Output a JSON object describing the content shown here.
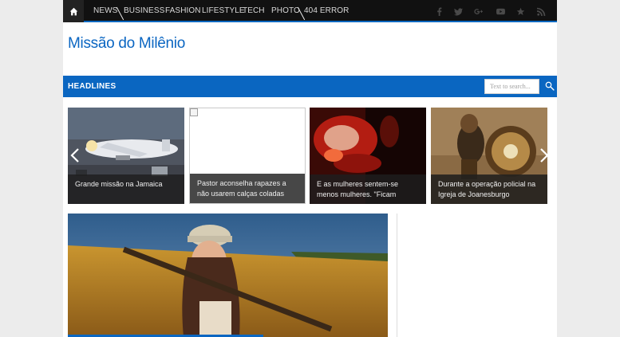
{
  "nav": {
    "home_icon": "home-icon",
    "items": [
      "NEWS",
      "BUSINESS",
      "FASHION",
      "LIFESTYLE",
      "TECH",
      "PHOTO",
      "404 ERROR"
    ]
  },
  "social_icons": [
    "facebook-icon",
    "twitter-icon",
    "google-plus-icon",
    "youtube-icon",
    "star-icon",
    "rss-icon"
  ],
  "site": {
    "title": "Missão do Milênio"
  },
  "headlines": {
    "title": "HEADLINES",
    "search_placeholder": "Text to search..."
  },
  "slides": [
    {
      "caption": "Grande missão na Jamaica"
    },
    {
      "caption": "Pastor aconselha rapazes a não usarem calças coladas"
    },
    {
      "caption": "E as mulheres sentem-se menos mulheres. \"Ficam"
    },
    {
      "caption": "Durante a operação policial na Igreja de Joanesburgo"
    }
  ],
  "colors": {
    "accent": "#0a66c1",
    "nav_bg": "#111111",
    "page_bg": "#ececec"
  }
}
